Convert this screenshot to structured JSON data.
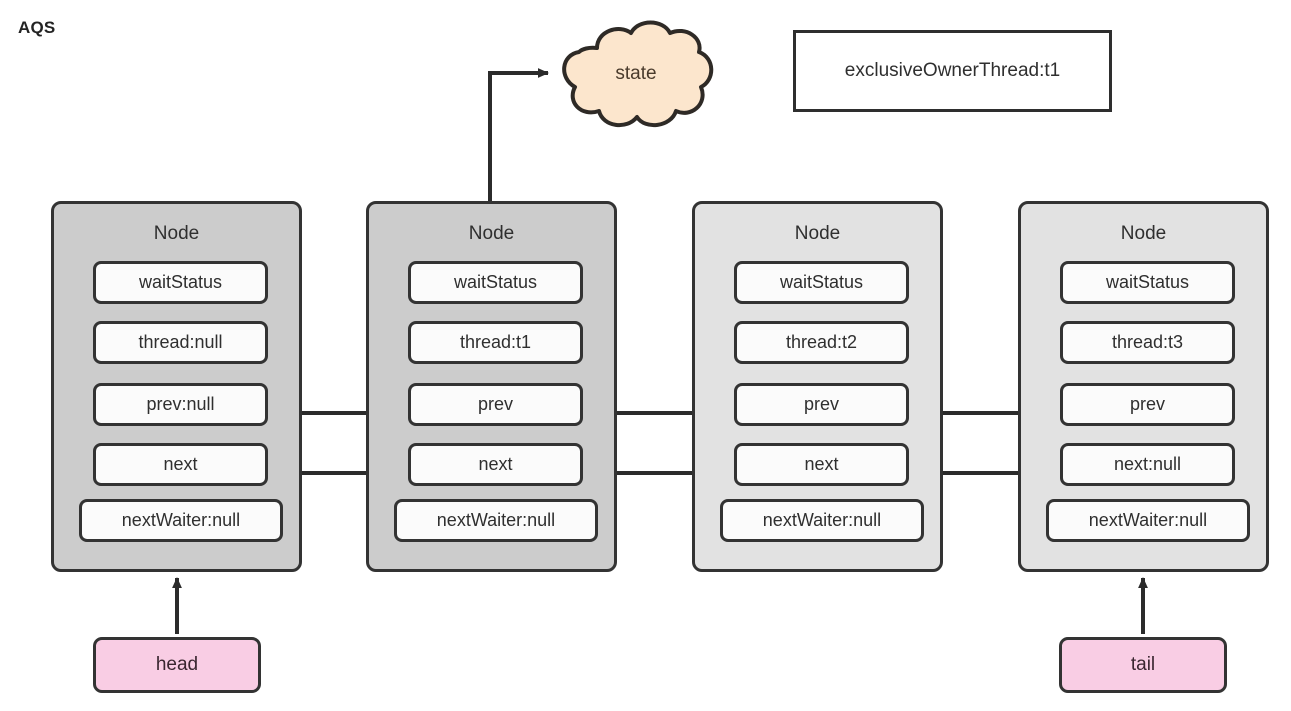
{
  "diagram": {
    "title": "AQS",
    "state_cloud": {
      "label": "state",
      "fill": "#fce6cd",
      "stroke": "#2e2a26"
    },
    "owner": {
      "label": "exclusiveOwnerThread:t1",
      "fill": "#ffffff",
      "stroke": "#2e2e2e"
    },
    "pointers": [
      {
        "label": "head",
        "fill": "#f9cde4"
      },
      {
        "label": "tail",
        "fill": "#f9cde4"
      }
    ],
    "field_names": {
      "wait_status": "waitStatus",
      "thread": "thread",
      "prev": "prev",
      "next": "next",
      "next_waiter": "nextWaiter"
    },
    "nodes": [
      {
        "title": "Node",
        "fill": "#cccccc",
        "stroke": "#333333",
        "fields": {
          "wait_status": "waitStatus",
          "thread": "thread:null",
          "prev": "prev:null",
          "next": "next",
          "next_waiter": "nextWaiter:null"
        }
      },
      {
        "title": "Node",
        "fill": "#cccccc",
        "stroke": "#333333",
        "fields": {
          "wait_status": "waitStatus",
          "thread": "thread:t1",
          "prev": "prev",
          "next": "next",
          "next_waiter": "nextWaiter:null"
        }
      },
      {
        "title": "Node",
        "fill": "#e2e2e2",
        "stroke": "#333333",
        "fields": {
          "wait_status": "waitStatus",
          "thread": "thread:t2",
          "prev": "prev",
          "next": "next",
          "next_waiter": "nextWaiter:null"
        }
      },
      {
        "title": "Node",
        "fill": "#e2e2e2",
        "stroke": "#333333",
        "fields": {
          "wait_status": "waitStatus",
          "thread": "thread:t3",
          "prev": "prev",
          "next": "next:null",
          "next_waiter": "nextWaiter:null"
        }
      }
    ],
    "connector_color": "#2b2b2b"
  }
}
